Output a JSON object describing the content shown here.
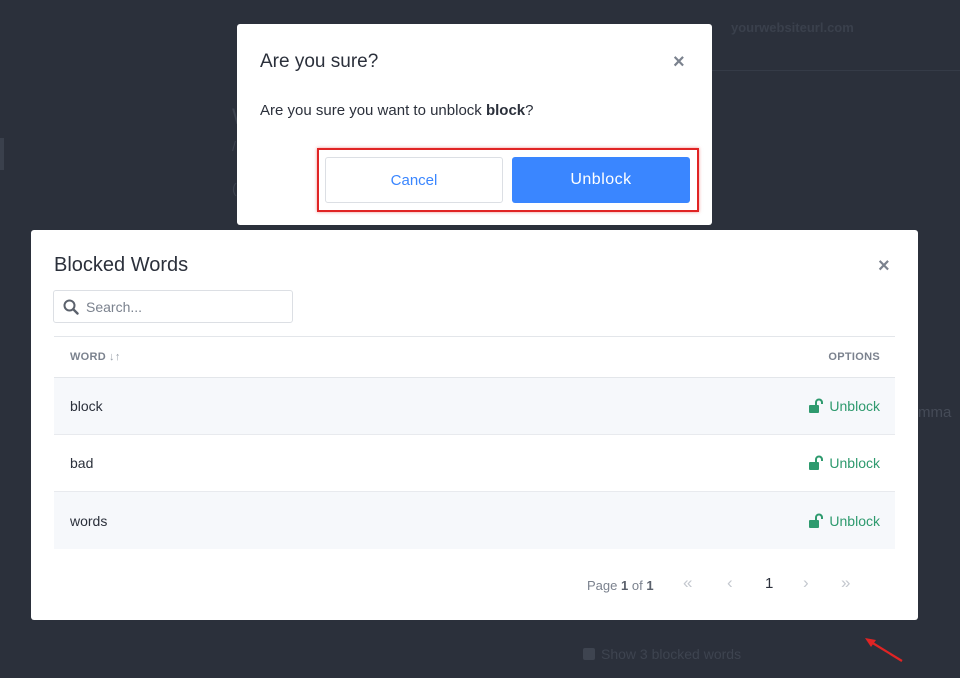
{
  "background": {
    "url_text": "yourwebsiteurl.com",
    "heading_fragment": "W",
    "line_fragment": "/",
    "dot_fragment": "(",
    "right_fragment": "mma",
    "footer_text": "Show 3 blocked words"
  },
  "confirm_dialog": {
    "title": "Are you sure?",
    "close_icon": "×",
    "message_prefix": "Are you sure you want to unblock ",
    "message_word": "block",
    "message_suffix": "?",
    "cancel_label": "Cancel",
    "confirm_label": "Unblock",
    "primary_color": "#3a86ff",
    "highlight_color": "#e02424"
  },
  "blocked_words": {
    "title": "Blocked Words",
    "close_icon": "×",
    "search": {
      "placeholder": "Search..."
    },
    "columns": {
      "word": "WORD",
      "options": "OPTIONS"
    },
    "sort_icon": "↓↑",
    "rows": [
      {
        "word": "block",
        "action": "Unblock"
      },
      {
        "word": "bad",
        "action": "Unblock"
      },
      {
        "word": "words",
        "action": "Unblock"
      }
    ],
    "action_color": "#2e9a6e",
    "pagination": {
      "page_label": "Page",
      "current": "1",
      "of_label": "of",
      "total": "1",
      "first_icon": "«",
      "prev_icon": "‹",
      "page_number": "1",
      "next_icon": "›",
      "last_icon": "»"
    }
  }
}
